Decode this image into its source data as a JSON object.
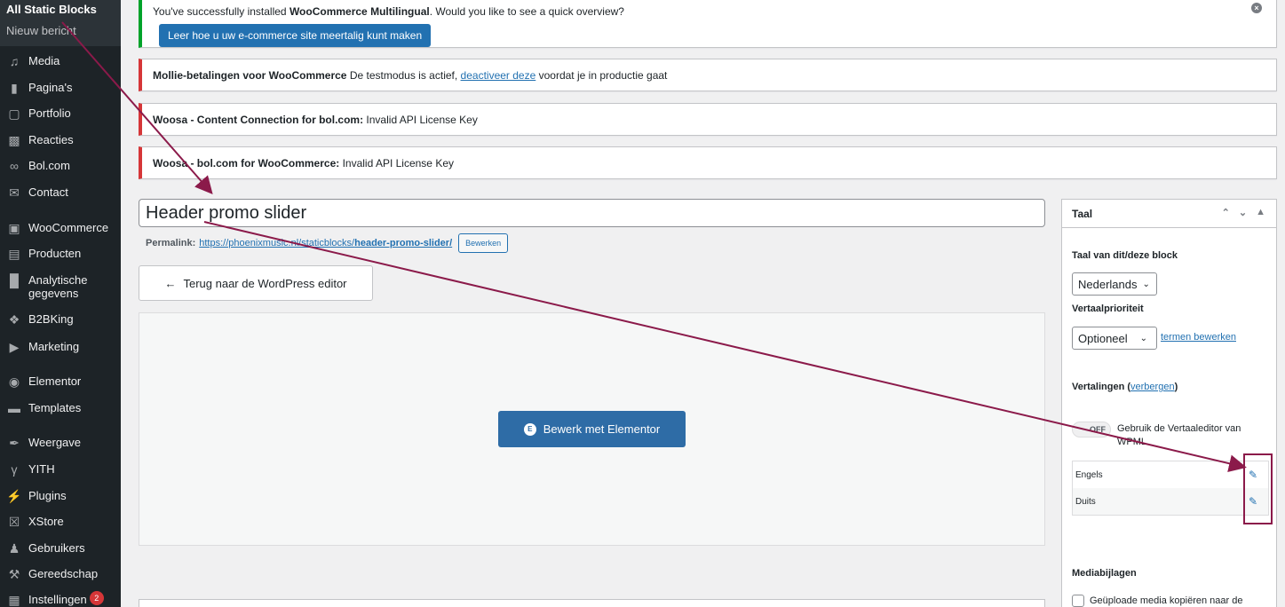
{
  "sidebar": {
    "submenu": [
      {
        "label": "All Static Blocks"
      },
      {
        "label": "Nieuw bericht"
      }
    ],
    "items": [
      {
        "label": "Media",
        "icon": "media-icon"
      },
      {
        "label": "Pagina's",
        "icon": "pages-icon"
      },
      {
        "label": "Portfolio",
        "icon": "portfolio-icon"
      },
      {
        "label": "Reacties",
        "icon": "comments-icon"
      },
      {
        "label": "Bol.com",
        "icon": "bolcom-icon"
      },
      {
        "label": "Contact",
        "icon": "mail-icon"
      },
      {
        "label": "WooCommerce",
        "icon": "woocommerce-icon"
      },
      {
        "label": "Producten",
        "icon": "products-icon"
      },
      {
        "label": "Analytische gegevens",
        "icon": "analytics-icon"
      },
      {
        "label": "B2BKing",
        "icon": "b2bking-icon"
      },
      {
        "label": "Marketing",
        "icon": "megaphone-icon"
      },
      {
        "label": "Elementor",
        "icon": "elementor-icon"
      },
      {
        "label": "Templates",
        "icon": "folder-icon"
      },
      {
        "label": "Weergave",
        "icon": "brush-icon"
      },
      {
        "label": "YITH",
        "icon": "yith-icon"
      },
      {
        "label": "Plugins",
        "icon": "plugin-icon"
      },
      {
        "label": "XStore",
        "icon": "xstore-icon"
      },
      {
        "label": "Gebruikers",
        "icon": "users-icon"
      },
      {
        "label": "Gereedschap",
        "icon": "wrench-icon"
      },
      {
        "label": "Instellingen",
        "icon": "settings-icon",
        "badge": "2"
      }
    ]
  },
  "notices": {
    "wpml": {
      "text_pre": "You've successfully installed ",
      "text_bold": "WooCommerce Multilingual",
      "text_post": ". Would you like to see a quick overview?",
      "button": "Leer hoe u uw e-commerce site meertalig kunt maken",
      "dismiss": "×"
    },
    "mollie": {
      "bold": "Mollie-betalingen voor WooCommerce",
      "text": " De testmodus is actief, ",
      "link": "deactiveer deze",
      "text_post": " voordat je in productie gaat"
    },
    "woosa1": {
      "bold": "Woosa - Content Connection for bol.com:",
      "text": " Invalid API License Key"
    },
    "woosa2": {
      "bold": "Woosa - bol.com for WooCommerce:",
      "text": " Invalid API License Key"
    }
  },
  "editor": {
    "title": "Header promo slider",
    "permalink_label": "Permalink:",
    "permalink_base": "https://phoenixmusic.nl/staticblocks/",
    "permalink_slug": "header-promo-slider/",
    "edit_button": "Bewerken",
    "back_button": "Terug naar de WordPress editor",
    "elementor_button": "Bewerk met Elementor"
  },
  "language_panel": {
    "title": "Taal",
    "language_label": "Taal van dit/deze block",
    "language_value": "Nederlands",
    "priority_label": "Vertaalprioriteit",
    "priority_value": "Optioneel",
    "terms_link": "termen bewerken",
    "translations_label": "Vertalingen",
    "translations_hide": "verbergen",
    "toggle_state": "OFF",
    "toggle_label": "Gebruik de Vertaaleditor van WPML",
    "translations": [
      {
        "language": "Engels"
      },
      {
        "language": "Duits"
      }
    ],
    "media_title": "Mediabijlagen",
    "media_checkbox": "Geüploade media kopiëren naar de"
  },
  "colors": {
    "sidebar_bg": "#1d2327",
    "primary": "#2271b1",
    "elementor": "#2e6ca6",
    "annotation": "#8b1a4a",
    "success": "#00a32a",
    "error": "#d63638"
  }
}
